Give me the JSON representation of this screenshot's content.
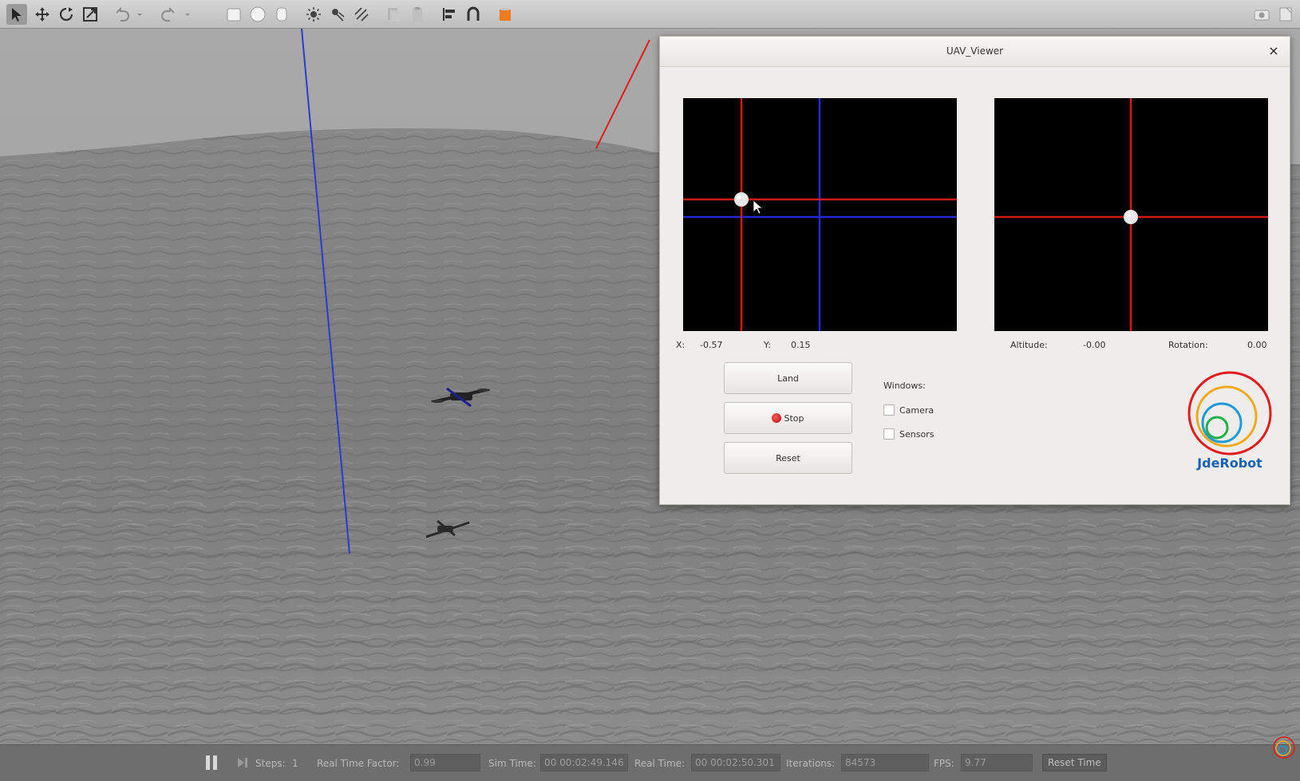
{
  "toolbar": {
    "icons": [
      "select-arrow-icon",
      "translate-icon",
      "rotate-icon",
      "scale-icon",
      "undo-icon",
      "undo-dropdown-icon",
      "redo-icon",
      "redo-dropdown-icon",
      "box-icon",
      "sphere-icon",
      "cylinder-icon",
      "point-light-icon",
      "spot-light-icon",
      "directional-light-icon",
      "copy-icon",
      "paste-icon",
      "align-icon",
      "snap-icon",
      "orange-model-icon",
      "screenshot-icon",
      "log-icon"
    ]
  },
  "viewer": {
    "title": "UAV_Viewer",
    "close": "×",
    "left_panel": {
      "x_label": "X:",
      "x_value": "-0.57",
      "y_label": "Y:",
      "y_value": "0.15"
    },
    "right_panel": {
      "altitude_label": "Altitude:",
      "altitude_value": "-0.00",
      "rotation_label": "Rotation:",
      "rotation_value": "0.00"
    },
    "buttons": {
      "land": "Land",
      "stop": "Stop",
      "reset": "Reset"
    },
    "windows": {
      "label": "Windows:",
      "camera": "Camera",
      "sensors": "Sensors",
      "camera_checked": false,
      "sensors_checked": false
    },
    "logo_text": "JdeRobot"
  },
  "statusbar": {
    "steps_label": "Steps:",
    "steps_value": "1",
    "rtf_label": "Real Time Factor:",
    "rtf_value": "0.99",
    "sim_time_label": "Sim Time:",
    "sim_time_value": "00 00:02:49.146",
    "real_time_label": "Real Time:",
    "real_time_value": "00 00:02:50.301",
    "iterations_label": "Iterations:",
    "iterations_value": "84573",
    "fps_label": "FPS:",
    "fps_value": "9.77",
    "reset_time": "Reset Time"
  },
  "colors": {
    "accent_red": "#e21b1b",
    "accent_blue": "#1f3bd6",
    "logo_blue": "#1a5fb4"
  }
}
